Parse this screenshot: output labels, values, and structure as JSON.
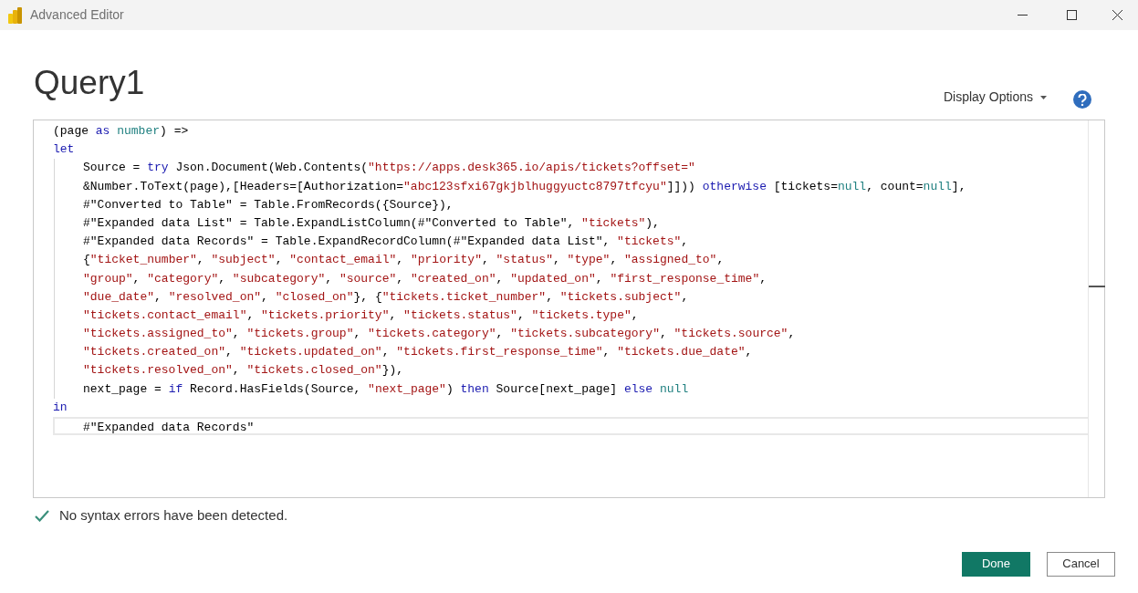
{
  "window": {
    "title": "Advanced Editor"
  },
  "query_title": "Query1",
  "display_options": {
    "label": "Display Options"
  },
  "editor": {
    "lines": [
      {
        "current": false,
        "tokens": [
          {
            "kind": "plain",
            "text": "(page "
          },
          {
            "kind": "keyword",
            "text": "as "
          },
          {
            "kind": "literal",
            "text": "number"
          },
          {
            "kind": "plain",
            "text": ") =>"
          }
        ]
      },
      {
        "current": false,
        "tokens": [
          {
            "kind": "keyword",
            "text": "let"
          }
        ],
        "children": [
          {
            "current": false,
            "tokens": [
              {
                "kind": "plain",
                "text": "Source = "
              },
              {
                "kind": "keyword",
                "text": "try"
              },
              {
                "kind": "plain",
                "text": " Json.Document(Web.Contents("
              },
              {
                "kind": "string",
                "text": "\"https://apps.desk365.io/apis/tickets?offset=\""
              }
            ]
          },
          {
            "current": false,
            "tokens": [
              {
                "kind": "plain",
                "text": "&Number.ToText(page),[Headers=[Authorization="
              },
              {
                "kind": "string",
                "text": "\"abc123sfxi67gkjblhuggyuctc8797tfcyu\""
              },
              {
                "kind": "plain",
                "text": "]])) "
              },
              {
                "kind": "keyword",
                "text": "otherwise"
              },
              {
                "kind": "plain",
                "text": " [tickets="
              },
              {
                "kind": "literal",
                "text": "null"
              },
              {
                "kind": "plain",
                "text": ", count="
              },
              {
                "kind": "literal",
                "text": "null"
              },
              {
                "kind": "plain",
                "text": "],"
              }
            ]
          },
          {
            "current": false,
            "tokens": [
              {
                "kind": "plain",
                "text": "#\"Converted to Table\" = Table.FromRecords({Source}),"
              }
            ]
          },
          {
            "current": false,
            "tokens": [
              {
                "kind": "plain",
                "text": "#\"Expanded data List\" = Table.ExpandListColumn(#\"Converted to Table\", "
              },
              {
                "kind": "string",
                "text": "\"tickets\""
              },
              {
                "kind": "plain",
                "text": "),"
              }
            ]
          },
          {
            "current": false,
            "tokens": [
              {
                "kind": "plain",
                "text": "#\"Expanded data Records\" = Table.ExpandRecordColumn(#\"Expanded data List\", "
              },
              {
                "kind": "string",
                "text": "\"tickets\""
              },
              {
                "kind": "plain",
                "text": ","
              }
            ]
          },
          {
            "current": false,
            "tokens": [
              {
                "kind": "plain",
                "text": "{"
              },
              {
                "kind": "string",
                "text": "\"ticket_number\""
              },
              {
                "kind": "plain",
                "text": ", "
              },
              {
                "kind": "string",
                "text": "\"subject\""
              },
              {
                "kind": "plain",
                "text": ", "
              },
              {
                "kind": "string",
                "text": "\"contact_email\""
              },
              {
                "kind": "plain",
                "text": ", "
              },
              {
                "kind": "string",
                "text": "\"priority\""
              },
              {
                "kind": "plain",
                "text": ", "
              },
              {
                "kind": "string",
                "text": "\"status\""
              },
              {
                "kind": "plain",
                "text": ", "
              },
              {
                "kind": "string",
                "text": "\"type\""
              },
              {
                "kind": "plain",
                "text": ", "
              },
              {
                "kind": "string",
                "text": "\"assigned_to\""
              },
              {
                "kind": "plain",
                "text": ","
              }
            ]
          },
          {
            "current": false,
            "tokens": [
              {
                "kind": "string",
                "text": "\"group\""
              },
              {
                "kind": "plain",
                "text": ", "
              },
              {
                "kind": "string",
                "text": "\"category\""
              },
              {
                "kind": "plain",
                "text": ", "
              },
              {
                "kind": "string",
                "text": "\"subcategory\""
              },
              {
                "kind": "plain",
                "text": ", "
              },
              {
                "kind": "string",
                "text": "\"source\""
              },
              {
                "kind": "plain",
                "text": ", "
              },
              {
                "kind": "string",
                "text": "\"created_on\""
              },
              {
                "kind": "plain",
                "text": ", "
              },
              {
                "kind": "string",
                "text": "\"updated_on\""
              },
              {
                "kind": "plain",
                "text": ", "
              },
              {
                "kind": "string",
                "text": "\"first_response_time\""
              },
              {
                "kind": "plain",
                "text": ","
              }
            ]
          },
          {
            "current": false,
            "tokens": [
              {
                "kind": "string",
                "text": "\"due_date\""
              },
              {
                "kind": "plain",
                "text": ", "
              },
              {
                "kind": "string",
                "text": "\"resolved_on\""
              },
              {
                "kind": "plain",
                "text": ", "
              },
              {
                "kind": "string",
                "text": "\"closed_on\""
              },
              {
                "kind": "plain",
                "text": "}, {"
              },
              {
                "kind": "string",
                "text": "\"tickets.ticket_number\""
              },
              {
                "kind": "plain",
                "text": ", "
              },
              {
                "kind": "string",
                "text": "\"tickets.subject\""
              },
              {
                "kind": "plain",
                "text": ","
              }
            ]
          },
          {
            "current": false,
            "tokens": [
              {
                "kind": "string",
                "text": "\"tickets.contact_email\""
              },
              {
                "kind": "plain",
                "text": ", "
              },
              {
                "kind": "string",
                "text": "\"tickets.priority\""
              },
              {
                "kind": "plain",
                "text": ", "
              },
              {
                "kind": "string",
                "text": "\"tickets.status\""
              },
              {
                "kind": "plain",
                "text": ", "
              },
              {
                "kind": "string",
                "text": "\"tickets.type\""
              },
              {
                "kind": "plain",
                "text": ","
              }
            ]
          },
          {
            "current": false,
            "tokens": [
              {
                "kind": "string",
                "text": "\"tickets.assigned_to\""
              },
              {
                "kind": "plain",
                "text": ", "
              },
              {
                "kind": "string",
                "text": "\"tickets.group\""
              },
              {
                "kind": "plain",
                "text": ", "
              },
              {
                "kind": "string",
                "text": "\"tickets.category\""
              },
              {
                "kind": "plain",
                "text": ", "
              },
              {
                "kind": "string",
                "text": "\"tickets.subcategory\""
              },
              {
                "kind": "plain",
                "text": ", "
              },
              {
                "kind": "string",
                "text": "\"tickets.source\""
              },
              {
                "kind": "plain",
                "text": ","
              }
            ]
          },
          {
            "current": false,
            "tokens": [
              {
                "kind": "string",
                "text": "\"tickets.created_on\""
              },
              {
                "kind": "plain",
                "text": ", "
              },
              {
                "kind": "string",
                "text": "\"tickets.updated_on\""
              },
              {
                "kind": "plain",
                "text": ", "
              },
              {
                "kind": "string",
                "text": "\"tickets.first_response_time\""
              },
              {
                "kind": "plain",
                "text": ", "
              },
              {
                "kind": "string",
                "text": "\"tickets.due_date\""
              },
              {
                "kind": "plain",
                "text": ","
              }
            ]
          },
          {
            "current": false,
            "tokens": [
              {
                "kind": "string",
                "text": "\"tickets.resolved_on\""
              },
              {
                "kind": "plain",
                "text": ", "
              },
              {
                "kind": "string",
                "text": "\"tickets.closed_on\""
              },
              {
                "kind": "plain",
                "text": "}),"
              }
            ]
          },
          {
            "current": false,
            "tokens": [
              {
                "kind": "plain",
                "text": "next_page = "
              },
              {
                "kind": "keyword",
                "text": "if"
              },
              {
                "kind": "plain",
                "text": " Record.HasFields(Source, "
              },
              {
                "kind": "string",
                "text": "\"next_page\""
              },
              {
                "kind": "plain",
                "text": ") "
              },
              {
                "kind": "keyword",
                "text": "then"
              },
              {
                "kind": "plain",
                "text": " Source[next_page] "
              },
              {
                "kind": "keyword",
                "text": "else "
              },
              {
                "kind": "literal",
                "text": "null"
              }
            ]
          }
        ]
      },
      {
        "current": false,
        "tokens": [
          {
            "kind": "keyword",
            "text": "in"
          }
        ],
        "children": [
          {
            "current": true,
            "tokens": [
              {
                "kind": "plain",
                "text": "#\"Expanded data Records\""
              }
            ]
          }
        ]
      }
    ]
  },
  "status": {
    "message": "No syntax errors have been detected."
  },
  "buttons": [
    {
      "label": "Done",
      "kind": "primary"
    },
    {
      "label": "Cancel",
      "kind": "secondary"
    }
  ]
}
